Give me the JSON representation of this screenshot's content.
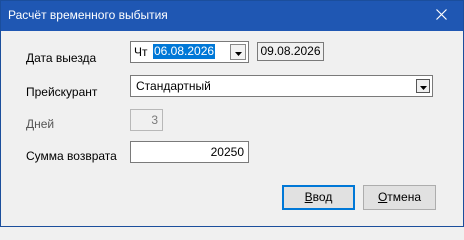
{
  "window": {
    "title": "Расчёт временного выбытия"
  },
  "icons": {
    "close": "close-icon",
    "dropdown": "chevron-down-icon"
  },
  "form": {
    "departure": {
      "label": "Дата выезда",
      "weekday": "Чт",
      "date": "06.08.2026"
    },
    "return_date": "09.08.2026",
    "pricelist": {
      "label": "Прейскурант",
      "value": "Стандартный"
    },
    "days": {
      "label": "Дней",
      "value": "3"
    },
    "refund": {
      "label": "Сумма возврата",
      "value": "20250"
    }
  },
  "buttons": {
    "ok": {
      "mnemonic": "В",
      "rest": "вод"
    },
    "cancel": {
      "mnemonic": "О",
      "rest": "тмена"
    }
  },
  "colors": {
    "titlebar": "#1f57b3",
    "selection": "#0078d7",
    "default_button_border": "#0078d7"
  }
}
